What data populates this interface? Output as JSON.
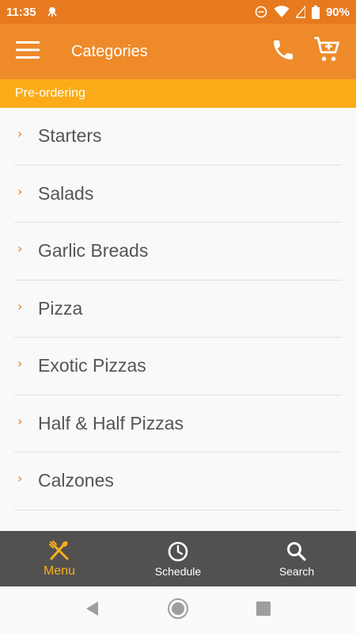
{
  "status": {
    "time": "11:35",
    "battery": "90%"
  },
  "app_bar": {
    "title": "Categories"
  },
  "banner": {
    "text": "Pre-ordering"
  },
  "categories": [
    {
      "label": "Starters"
    },
    {
      "label": "Salads"
    },
    {
      "label": "Garlic Breads"
    },
    {
      "label": "Pizza"
    },
    {
      "label": "Exotic Pizzas"
    },
    {
      "label": "Half & Half Pizzas"
    },
    {
      "label": "Calzones"
    }
  ],
  "bottom_nav": {
    "items": [
      {
        "label": "Menu",
        "icon": "utensils-icon",
        "active": true
      },
      {
        "label": "Schedule",
        "icon": "clock-icon",
        "active": false
      },
      {
        "label": "Search",
        "icon": "search-icon",
        "active": false
      }
    ]
  },
  "colors": {
    "primary": "#ee8a2a",
    "banner": "#fbab18",
    "nav_bg": "#535050",
    "active": "#f5b21a"
  }
}
